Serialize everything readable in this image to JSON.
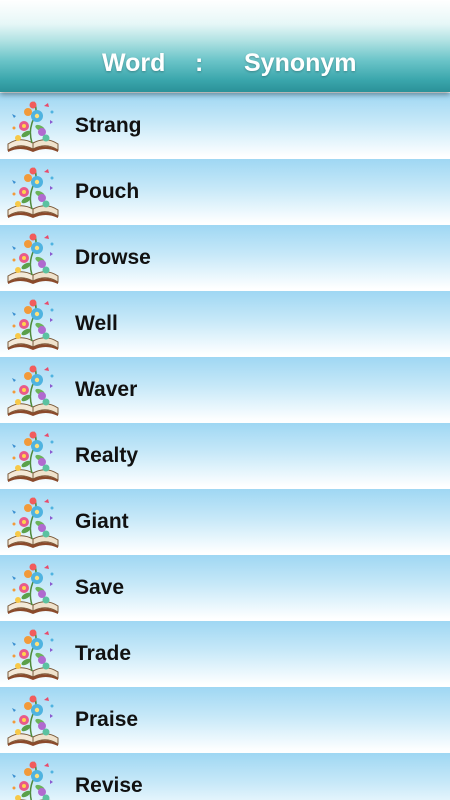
{
  "header": {
    "word_label": "Word",
    "separator": ":",
    "synonym_label": "Synonym"
  },
  "list": {
    "icon": "book-flowers-icon",
    "items": [
      {
        "label": "Strang"
      },
      {
        "label": "Pouch"
      },
      {
        "label": "Drowse"
      },
      {
        "label": "Well"
      },
      {
        "label": "Waver"
      },
      {
        "label": "Realty"
      },
      {
        "label": "Giant"
      },
      {
        "label": "Save"
      },
      {
        "label": "Trade"
      },
      {
        "label": "Praise"
      },
      {
        "label": "Revise"
      }
    ]
  },
  "colors": {
    "header_teal": "#2b9198",
    "row_blue": "#9fd7f3",
    "text": "#111111"
  }
}
